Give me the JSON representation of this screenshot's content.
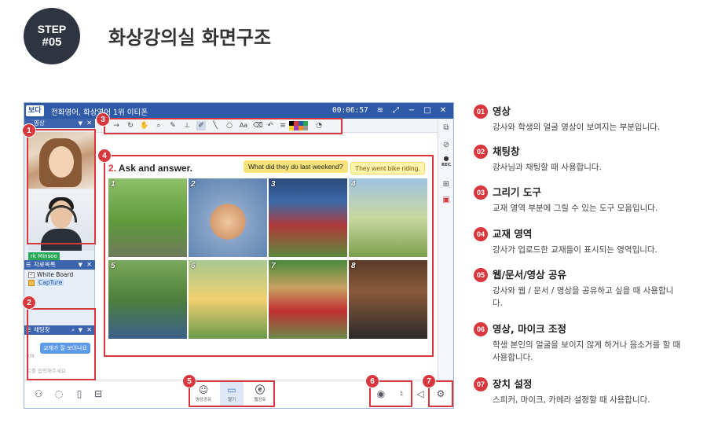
{
  "header": {
    "step_line1": "STEP",
    "step_line2": "#05",
    "title": "화상강의실 화면구조"
  },
  "window": {
    "logo": "보다",
    "title": "전화영어, 화상영어 1위 이티폰",
    "timer": "00:06:57",
    "controls": {
      "wifi": "≋",
      "restore": "⤢",
      "minimize": "−",
      "maximize": "□",
      "close": "✕"
    }
  },
  "panels": {
    "video_header": "영상",
    "student_name": "rk Minsoo",
    "materials_header": "자료목록",
    "materials": [
      {
        "label": "White Board",
        "checked": true
      },
      {
        "label": "CapTure",
        "selected": true
      }
    ],
    "chat_header": "채팅창",
    "chat_message": "교재가 잘 보이나요",
    "chat_time": ":09",
    "chat_placeholder": "트를 입력해주세요"
  },
  "lesson": {
    "number": "2.",
    "title": "Ask and answer.",
    "question": "What did they do last weekend?",
    "answer": "They went bike riding.",
    "photo_numbers": [
      "1",
      "2",
      "3",
      "4",
      "5",
      "6",
      "7",
      "8"
    ]
  },
  "right_strip": {
    "rec_label": "REC"
  },
  "bottom": {
    "share_buttons": [
      {
        "label": "영상공유"
      },
      {
        "label": "열기"
      },
      {
        "label": "웹공유"
      }
    ]
  },
  "markers": [
    "1",
    "2",
    "3",
    "4",
    "5",
    "6",
    "7"
  ],
  "legend": [
    {
      "num": "01",
      "title": "영상",
      "desc": "강사와 학생의 얼굴 영상이 보여지는 부분입니다."
    },
    {
      "num": "02",
      "title": "채팅창",
      "desc": "강사님과 채팅할 때 사용합니다."
    },
    {
      "num": "03",
      "title": "그리기 도구",
      "desc": "교재 영역 부분에 그릴 수 있는 도구 모음입니다."
    },
    {
      "num": "04",
      "title": "교재 영역",
      "desc": "강사가 업로드한 교재들이 표시되는 영역입니다."
    },
    {
      "num": "05",
      "title": "웹/문서/영상 공유",
      "desc": "강사와 웹 / 문서 / 영상을 공유하고 싶을 때 사용합니다."
    },
    {
      "num": "06",
      "title": "영상, 마이크 조정",
      "desc": "학생 본인의 얼굴을 보이지 않게 하거나 음소거를 할 때 사용합니다."
    },
    {
      "num": "07",
      "title": "장치 설정",
      "desc": "스피커, 마이크, 카메라 설정할 때 사용합니다."
    }
  ],
  "colors": {
    "accent_red": "#d8383d",
    "titlebar_blue": "#2f5aa8",
    "badge_dark": "#2e3440"
  }
}
